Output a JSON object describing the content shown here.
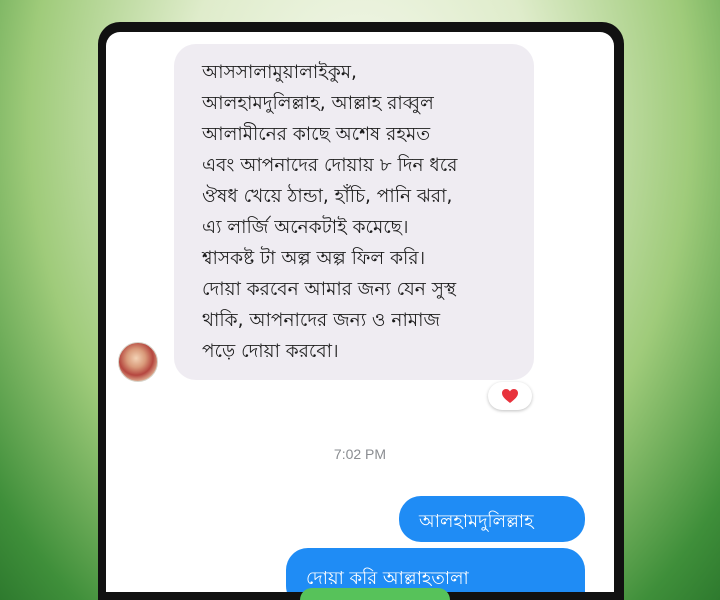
{
  "conversation": {
    "incoming_message": {
      "lines": [
        "আসসালামুয়ালাইকুম,",
        "আলহামদুলিল্লাহ, আল্লাহ রাব্বুল",
        "আলামীনের কাছে অশেষ রহমত",
        "এবং আপনাদের দোয়ায় ৮ দিন ধরে",
        "ঔষধ খেয়ে ঠান্ডা, হাঁচি, পানি ঝরা,",
        "এ্য লার্জি অনেকটাই কমেছে।",
        "শ্বাসকষ্ট টা অল্প অল্প ফিল করি।",
        "দোয়া করবেন আমার জন্য যেন সুস্থ",
        "থাকি, আপনাদের জন্য ও  নামাজ",
        "পড়ে দোয়া করবো।"
      ],
      "reaction_icon": "heart-icon",
      "reaction_color": "#e8323c"
    },
    "timestamp": "7:02 PM",
    "outgoing_messages": [
      "আলহামদুলিল্লাহ",
      "দোয়া করি আল্লাহতালা"
    ]
  },
  "colors": {
    "outgoing_bubble": "#1f8cf5",
    "incoming_bubble": "#efecf2",
    "background_green": "#3f8f3a"
  }
}
